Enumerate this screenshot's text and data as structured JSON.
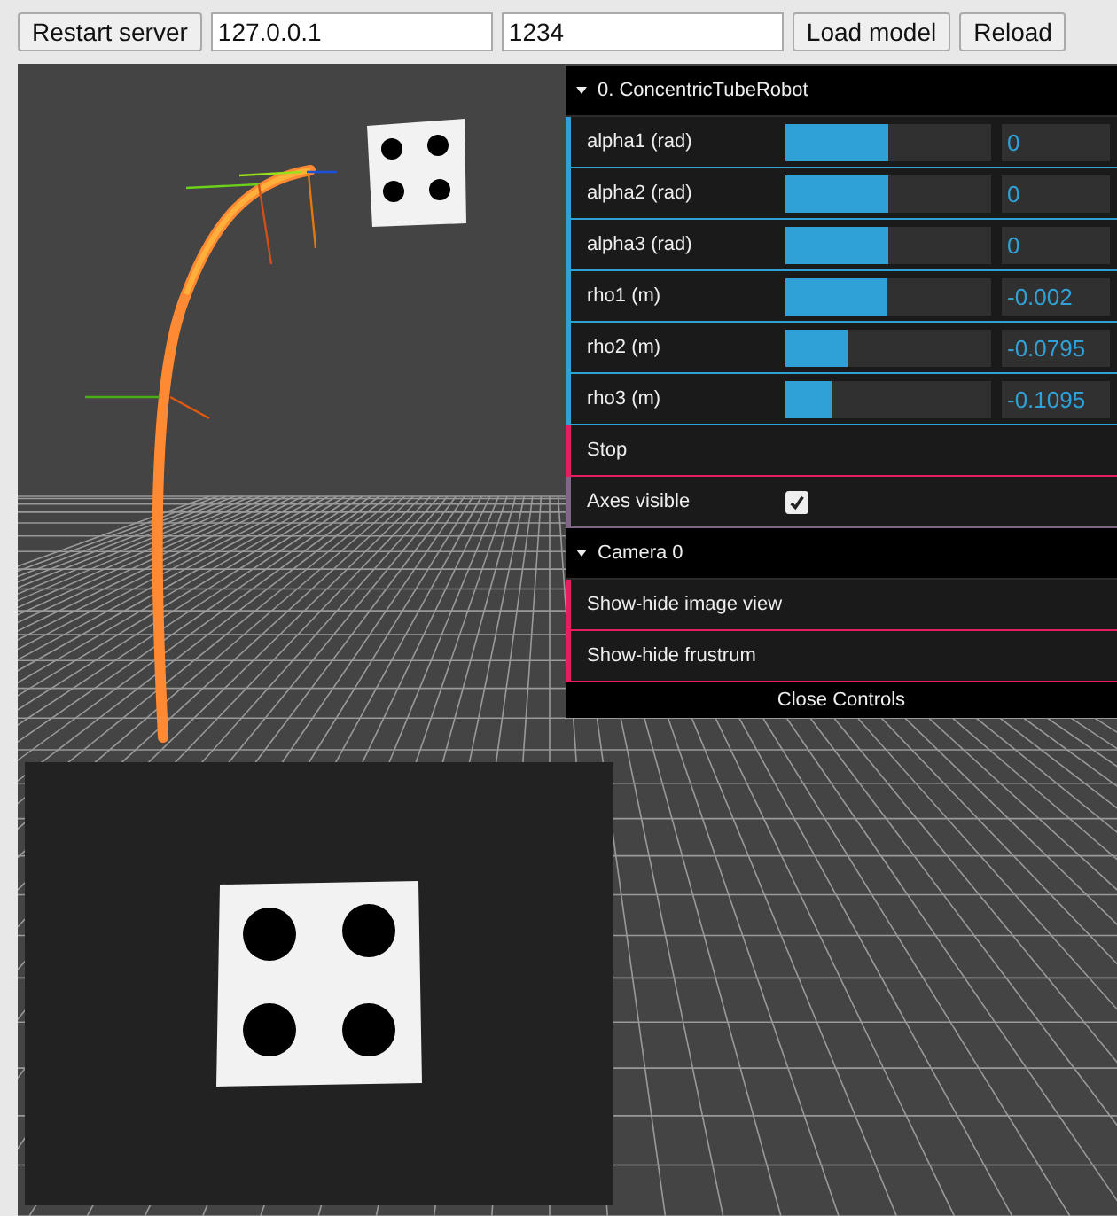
{
  "toolbar": [
    {
      "kind": "button",
      "label": "Restart server"
    },
    {
      "kind": "input",
      "value": "127.0.0.1"
    },
    {
      "kind": "input",
      "value": "1234"
    },
    {
      "kind": "button",
      "label": "Load model"
    },
    {
      "kind": "button",
      "label": "Reload"
    }
  ],
  "controls": {
    "folders": [
      {
        "title": "0. ConcentricTubeRobot",
        "expanded": true,
        "rows": [
          {
            "kind": "slider",
            "label": "alpha1 (rad)",
            "level": 0.5,
            "value": "0"
          },
          {
            "kind": "slider",
            "label": "alpha2 (rad)",
            "level": 0.5,
            "value": "0"
          },
          {
            "kind": "slider",
            "label": "alpha3 (rad)",
            "level": 0.5,
            "value": "0"
          },
          {
            "kind": "slider",
            "label": "rho1 (m)",
            "level": 0.49,
            "value": "-0.002"
          },
          {
            "kind": "slider",
            "label": "rho2 (m)",
            "level": 0.3,
            "value": "-0.0795"
          },
          {
            "kind": "slider",
            "label": "rho3 (m)",
            "level": 0.22,
            "value": "-0.1095"
          },
          {
            "kind": "button",
            "label": "Stop"
          },
          {
            "kind": "checkbox",
            "label": "Axes visible",
            "checked": true
          }
        ]
      },
      {
        "title": "Camera 0",
        "expanded": true,
        "rows": [
          {
            "kind": "button",
            "label": "Show-hide image view"
          },
          {
            "kind": "button",
            "label": "Show-hide frustrum"
          }
        ]
      }
    ],
    "close_label": "Close Controls"
  }
}
